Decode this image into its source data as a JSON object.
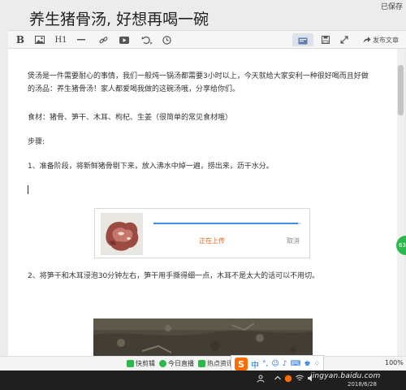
{
  "header": {
    "save_status": "已保存",
    "title": "养生猪骨汤, 好想再喝一碗"
  },
  "toolbar": {
    "bold": "B",
    "heading": "H1",
    "publish_label": "发布文章",
    "icons": [
      "bold-icon",
      "image-icon",
      "heading-icon",
      "divider-icon",
      "link-icon",
      "video-icon",
      "undo-icon",
      "history-icon",
      "preview-icon",
      "save-icon",
      "fullscreen-icon",
      "share-icon"
    ]
  },
  "editor": {
    "intro_line1": "煲汤是一件需要耐心的事情，我们一般炖一锅汤都需要3小时以上，今天就给大家安利一种很好喝而且好做",
    "intro_line2": "的汤品：养生猪骨汤！家人都爱喝我做的这碗汤哦，分享给你们。",
    "ingredients": "食材：猪骨、笋干、木耳、枸杞、生姜（很简单的常见食材哦）",
    "steps_label": "步骤:",
    "step1": "1、准备阶段，将新鲜猪骨剔下来，放入沸水中焯一遍，捞出来，沥干水分。",
    "step2": "2、将笋干和木耳浸泡30分钟左右，笋干用手撕得细一点，木耳不是太大的话可以不用切。",
    "upload": {
      "status": "正在上传",
      "cancel": "取消",
      "progress": 0.98
    }
  },
  "side_badge": "63",
  "bottom_strip": {
    "items": [
      "快剪辑",
      "今日直播",
      "热点资讯"
    ],
    "zoom": "100%"
  },
  "ime": {
    "logo": "S",
    "mode": "中",
    "punct": "°,",
    "skin": "☺",
    "mic": "♪",
    "keyboard": "⌨",
    "shirt": "♚",
    "grid": "⁘"
  },
  "taskbar": {
    "date": "2018/6/28"
  },
  "watermark": "jingyan.baidu.com",
  "colors": {
    "accent": "#3a8ee6",
    "upload_status": "#e36a1f",
    "badge": "#2db84d",
    "ime": "#ff6d00"
  }
}
